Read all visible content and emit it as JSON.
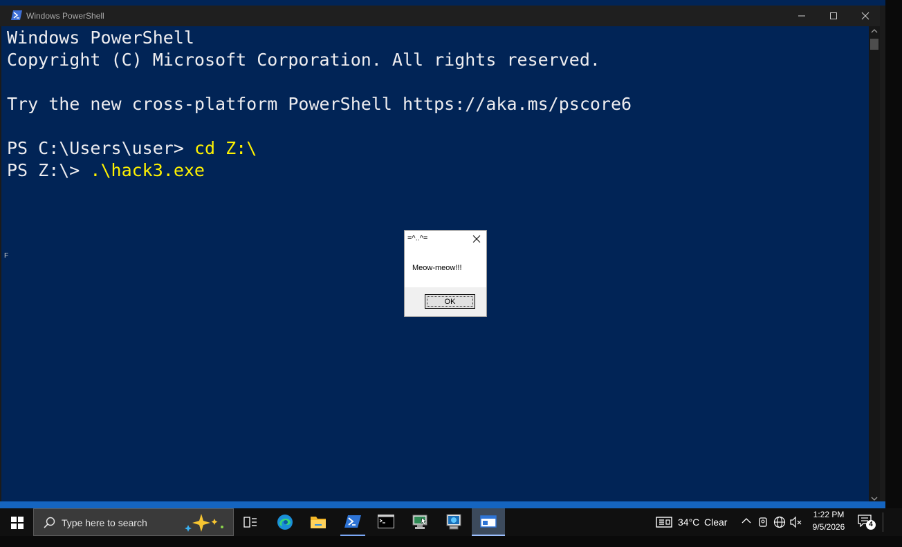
{
  "window": {
    "title": "Windows PowerShell"
  },
  "console": {
    "line1": "Windows PowerShell",
    "line2": "Copyright (C) Microsoft Corporation. All rights reserved.",
    "line4": "Try the new cross-platform PowerShell https://aka.ms/pscore6",
    "prompt1": "PS C:\\Users\\user> ",
    "command1": "cd Z:\\",
    "prompt2": "PS Z:\\> ",
    "command2": ".\\hack3.exe",
    "stray_char": "F",
    "command_color": "#fff200",
    "background_color": "#012456"
  },
  "message_box": {
    "title": "=^..^=",
    "text": "Meow-meow!!!",
    "ok_label": "OK"
  },
  "taskbar": {
    "search_placeholder": "Type here to search",
    "weather_temp": "34°C",
    "weather_condition": "Clear",
    "time": "1:22 PM",
    "date": "9/5/2026",
    "notification_count": "4",
    "icons": [
      "windows-start-icon",
      "search-icon",
      "task-view-icon",
      "edge-icon",
      "file-explorer-icon",
      "powershell-icon",
      "terminal-icon",
      "app-icon",
      "app-icon",
      "window-app-icon",
      "weather-icon",
      "chevron-up-icon",
      "meet-icon",
      "network-icon",
      "volume-muted-icon",
      "notification-icon"
    ]
  }
}
